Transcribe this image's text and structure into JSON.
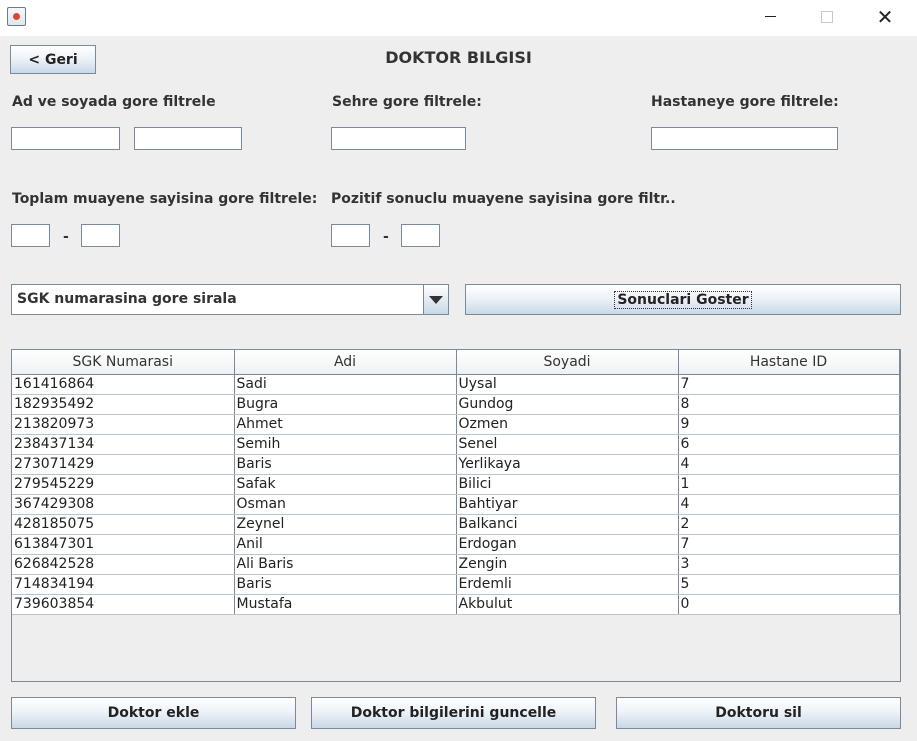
{
  "window": {
    "title": ""
  },
  "header": {
    "back_label": "< Geri",
    "title": "DOKTOR BILGISI"
  },
  "filters": {
    "name_label": "Ad ve soyada gore filtrele",
    "city_label": "Sehre gore filtrele:",
    "hospital_label": "Hastaneye gore filtrele:",
    "total_label": "Toplam muayene sayisina gore filtrele:",
    "positive_label": "Pozitif sonuclu muayene sayisina gore filtr..",
    "range_separator": "-"
  },
  "sort": {
    "selected": "SGK numarasina gore sirala"
  },
  "show_button": "Sonuclari Goster",
  "table": {
    "columns": [
      "SGK Numarasi",
      "Adi",
      "Soyadi",
      "Hastane ID"
    ],
    "rows": [
      [
        "161416864",
        "Sadi",
        "Uysal",
        "7"
      ],
      [
        "182935492",
        "Bugra",
        "Gundog",
        "8"
      ],
      [
        "213820973",
        "Ahmet",
        "Ozmen",
        "9"
      ],
      [
        "238437134",
        "Semih",
        "Senel",
        "6"
      ],
      [
        "273071429",
        "Baris",
        "Yerlikaya",
        "4"
      ],
      [
        "279545229",
        "Safak",
        "Bilici",
        "1"
      ],
      [
        "367429308",
        "Osman",
        "Bahtiyar",
        "4"
      ],
      [
        "428185075",
        "Zeynel",
        "Balkanci",
        "2"
      ],
      [
        "613847301",
        "Anil",
        "Erdogan",
        "7"
      ],
      [
        "626842528",
        "Ali Baris",
        "Zengin",
        "3"
      ],
      [
        "714834194",
        "Baris",
        "Erdemli",
        "5"
      ],
      [
        "739603854",
        "Mustafa",
        "Akbulut",
        "0"
      ]
    ]
  },
  "actions": {
    "add_label": "Doktor ekle",
    "update_label": "Doktor bilgilerini guncelle",
    "delete_label": "Doktoru sil"
  },
  "icons": {
    "app": "java-cup-icon",
    "minimize": "minimize-icon",
    "maximize": "maximize-icon",
    "close": "close-icon",
    "dropdown": "chevron-down-icon"
  }
}
